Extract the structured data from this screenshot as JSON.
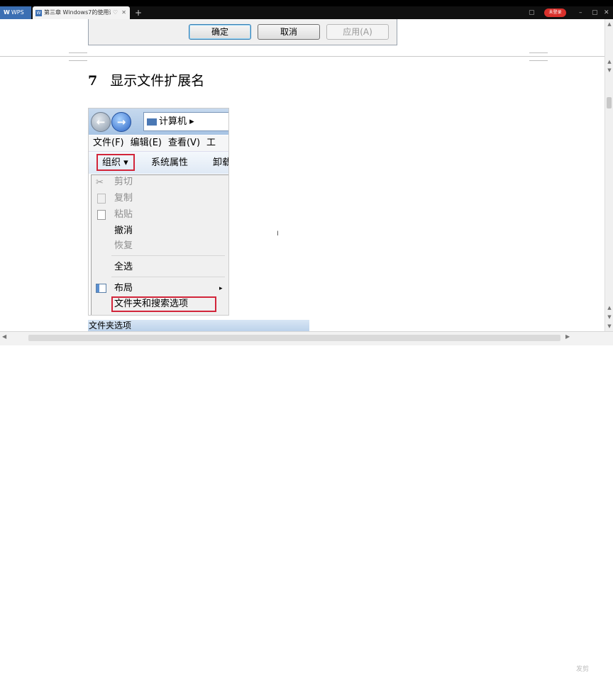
{
  "titlebar": {
    "app": "WPS",
    "tab_title": "第三章 Windows7的使用讲义",
    "pin": "♡",
    "close": "✕",
    "new_tab": "+",
    "login": "未登录",
    "controls": [
      "▢",
      "–",
      "▢",
      "✕"
    ]
  },
  "dialog": {
    "ok": "确定",
    "cancel": "取消",
    "apply": "应用(A)"
  },
  "heading": {
    "number": "7",
    "title": "显示文件扩展名"
  },
  "screenshot": {
    "address": "计算机 ▸",
    "menubar": [
      "文件(F)",
      "编辑(E)",
      "查看(V)",
      "工"
    ],
    "toolbar": {
      "organize": "组织 ▾",
      "system_props": "系统属性",
      "uninstall": "卸载"
    },
    "menu": {
      "cut": "剪切",
      "copy": "复制",
      "paste": "粘贴",
      "undo": "撤消",
      "redo": "恢复",
      "select_all": "全选",
      "layout": "布局",
      "layout_arrow": "▸",
      "folder_options": "文件夹和搜索选项"
    },
    "dialog_title": "文件夹选项"
  },
  "cursor": "I",
  "watermark": "发剪"
}
